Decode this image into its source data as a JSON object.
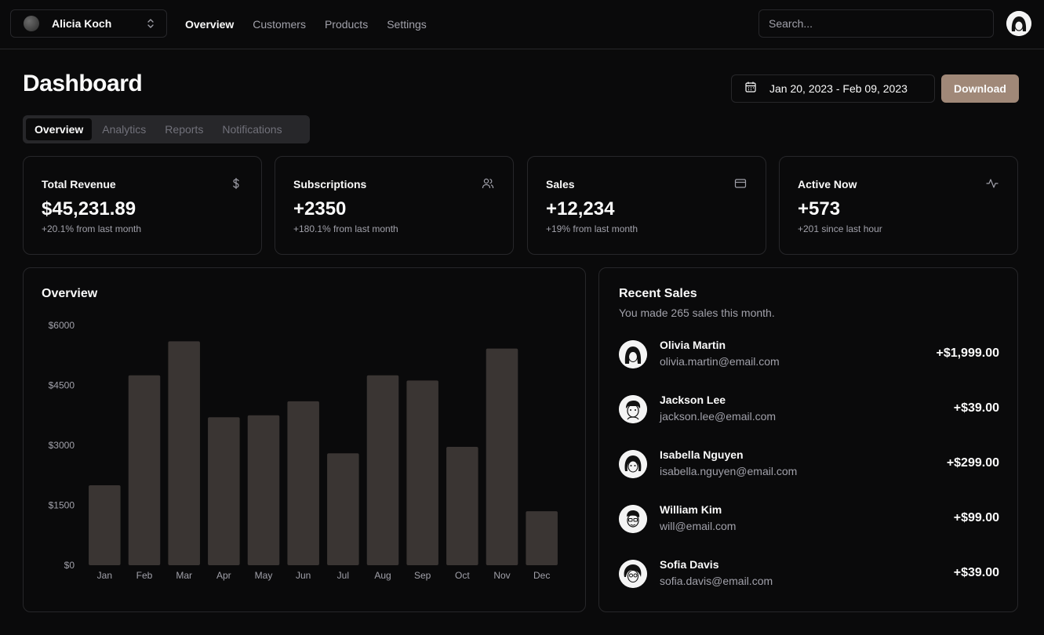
{
  "topbar": {
    "team_name": "Alicia Koch",
    "nav": [
      "Overview",
      "Customers",
      "Products",
      "Settings"
    ],
    "search_placeholder": "Search..."
  },
  "header": {
    "title": "Dashboard",
    "date_range": "Jan 20, 2023 - Feb 09, 2023",
    "download_label": "Download"
  },
  "tabs": [
    "Overview",
    "Analytics",
    "Reports",
    "Notifications"
  ],
  "kpis": [
    {
      "label": "Total Revenue",
      "value": "$45,231.89",
      "sub": "+20.1% from last month",
      "icon": "dollar-icon"
    },
    {
      "label": "Subscriptions",
      "value": "+2350",
      "sub": "+180.1% from last month",
      "icon": "users-icon"
    },
    {
      "label": "Sales",
      "value": "+12,234",
      "sub": "+19% from last month",
      "icon": "credit-card-icon"
    },
    {
      "label": "Active Now",
      "value": "+573",
      "sub": "+201 since last hour",
      "icon": "activity-icon"
    }
  ],
  "overview": {
    "title": "Overview"
  },
  "chart_data": {
    "type": "bar",
    "title": "",
    "categories": [
      "Jan",
      "Feb",
      "Mar",
      "Apr",
      "May",
      "Jun",
      "Jul",
      "Aug",
      "Sep",
      "Oct",
      "Nov",
      "Dec"
    ],
    "values": [
      2000,
      4750,
      5600,
      3700,
      3750,
      4100,
      2800,
      4750,
      4620,
      2960,
      5420,
      1350
    ],
    "yticks": [
      "$0",
      "$1500",
      "$3000",
      "$4500",
      "$6000"
    ],
    "ylim": [
      0,
      6000
    ],
    "xlabel": "",
    "ylabel": "",
    "bar_color": "#3a3533",
    "grid": false
  },
  "recent_sales": {
    "title": "Recent Sales",
    "description": "You made 265 sales this month.",
    "items": [
      {
        "name": "Olivia Martin",
        "email": "olivia.martin@email.com",
        "amount": "+$1,999.00"
      },
      {
        "name": "Jackson Lee",
        "email": "jackson.lee@email.com",
        "amount": "+$39.00"
      },
      {
        "name": "Isabella Nguyen",
        "email": "isabella.nguyen@email.com",
        "amount": "+$299.00"
      },
      {
        "name": "William Kim",
        "email": "will@email.com",
        "amount": "+$99.00"
      },
      {
        "name": "Sofia Davis",
        "email": "sofia.davis@email.com",
        "amount": "+$39.00"
      }
    ]
  },
  "colors": {
    "background": "#0a0a0b",
    "border": "#27272a",
    "accent": "#a08878",
    "muted_text": "#a1a1aa"
  }
}
